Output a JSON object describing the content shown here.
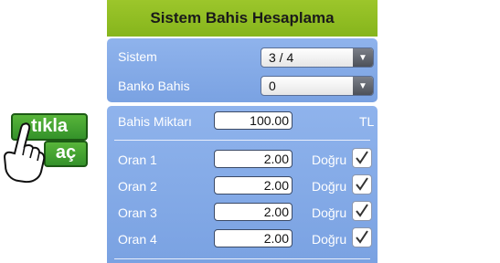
{
  "header": {
    "title": "Sistem Bahis Hesaplama"
  },
  "selectors": {
    "sistem_label": "Sistem",
    "sistem_value": "3 / 4",
    "banko_label": "Banko Bahis",
    "banko_value": "0"
  },
  "bet": {
    "label": "Bahis Miktarı",
    "value": "100.00",
    "currency": "TL"
  },
  "odds": [
    {
      "label": "Oran 1",
      "value": "2.00",
      "status": "Doğru",
      "checked": true
    },
    {
      "label": "Oran 2",
      "value": "2.00",
      "status": "Doğru",
      "checked": true
    },
    {
      "label": "Oran 3",
      "value": "2.00",
      "status": "Doğru",
      "checked": true
    },
    {
      "label": "Oran 4",
      "value": "2.00",
      "status": "Doğru",
      "checked": true
    }
  ],
  "promo": {
    "line1": "tıkla",
    "line2": "aç"
  },
  "icons": {
    "dropdown": "dropdown-arrow-icon",
    "check": "checkmark-icon",
    "hand": "pointing-hand-icon"
  },
  "colors": {
    "header": "#8fbe23",
    "panel": "#84aae7",
    "promo": "#3fa42e"
  }
}
